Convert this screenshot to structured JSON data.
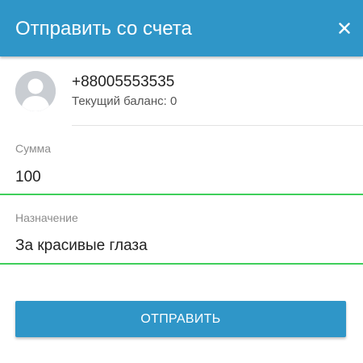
{
  "dialog": {
    "title": "Отправить со счета",
    "close_icon": "close-icon"
  },
  "account": {
    "avatar_icon": "user-avatar-icon",
    "phone": "+88005553535",
    "balance": "Текущий баланс: 0"
  },
  "form": {
    "amount_label": "Сумма",
    "amount_value": "100",
    "purpose_label": "Назначение",
    "purpose_value": "За красивые глаза"
  },
  "submit": {
    "label": "ОТПРАВИТЬ"
  },
  "colors": {
    "accent": "#2f96c8",
    "input_underline": "#3fcf5a"
  }
}
